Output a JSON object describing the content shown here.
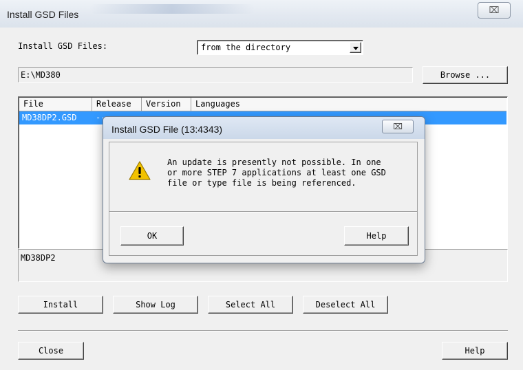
{
  "window": {
    "title": "Install GSD Files",
    "close_glyph": "⌧"
  },
  "source": {
    "label": "Install GSD Files:",
    "selected": "from the directory"
  },
  "path": {
    "value": "E:\\MD380",
    "browse_label": "Browse ..."
  },
  "table": {
    "columns": [
      "File",
      "Release",
      "Version",
      "Languages"
    ],
    "rows": [
      {
        "file": "MD38DP2.GSD",
        "release": "--"
      }
    ]
  },
  "description": "MD38DP2",
  "actions": {
    "install": "Install",
    "show_log": "Show Log",
    "select_all": "Select All",
    "deselect_all": "Deselect All"
  },
  "footer": {
    "close": "Close",
    "help": "Help"
  },
  "dialog": {
    "title": "Install GSD File (13:4343)",
    "close_glyph": "⌧",
    "message": [
      "An update is presently not possible. In one",
      "or more STEP 7 applications at least one GSD",
      "file or type file is being referenced."
    ],
    "ok": "OK",
    "help": "Help",
    "icon": "warning-icon",
    "icon_color": "#f2c200"
  }
}
